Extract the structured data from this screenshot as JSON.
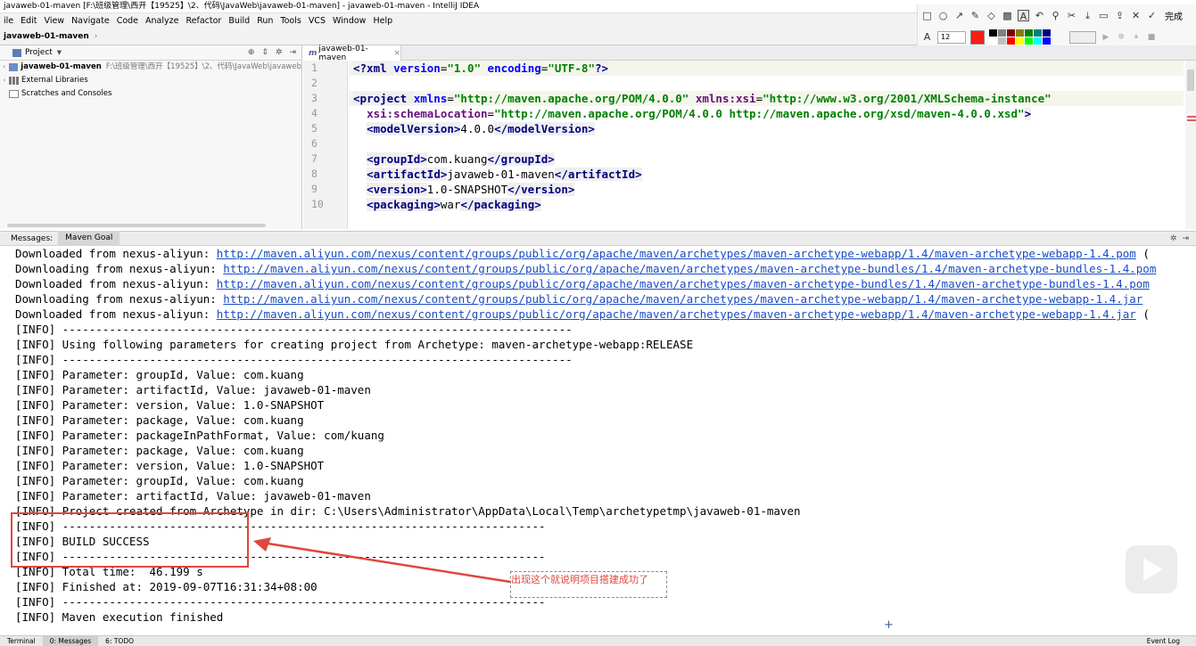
{
  "window": {
    "title": "javaweb-01-maven [F:\\班级管理\\西开【19525】\\2、代码\\JavaWeb\\javaweb-01-maven] - javaweb-01-maven - IntelliJ IDEA"
  },
  "menu": [
    "ile",
    "Edit",
    "View",
    "Navigate",
    "Code",
    "Analyze",
    "Refactor",
    "Build",
    "Run",
    "Tools",
    "VCS",
    "Window",
    "Help"
  ],
  "breadcrumb": {
    "project": "javaweb-01-maven"
  },
  "annotation_toolbar": {
    "done_label": "完成",
    "font_size": "12",
    "active_color": "#ff1a1a",
    "palette": [
      "#000000",
      "#808080",
      "#800000",
      "#808000",
      "#008000",
      "#008080",
      "#000080",
      "#ffffff",
      "#c0c0c0",
      "#ff0000",
      "#ffff00",
      "#00ff00",
      "#00ffff",
      "#0000ff"
    ]
  },
  "project_panel": {
    "title": "Project",
    "tree": [
      {
        "label": "javaweb-01-maven",
        "path": "F:\\班级管理\\西开【19525】\\2、代码\\JavaWeb\\javaweb"
      },
      {
        "label": "External Libraries"
      },
      {
        "label": "Scratches and Consoles"
      }
    ]
  },
  "editor": {
    "tab_label": "javaweb-01-maven",
    "lines": [
      "1",
      "2",
      "3",
      "4",
      "5",
      "6",
      "7",
      "8",
      "9",
      "10"
    ],
    "code": {
      "l1_a": "<?xml ",
      "l1_attr1": "version",
      "l1_eq1": "=",
      "l1_v1": "\"1.0\"",
      "l1_sp": " ",
      "l1_attr2": "encoding",
      "l1_eq2": "=",
      "l1_v2": "\"UTF-8\"",
      "l1_end": "?>",
      "l3_tag": "<project ",
      "l3_attr1": "xmlns",
      "l3_eq1": "=",
      "l3_v1": "\"http://maven.apache.org/POM/4.0.0\"",
      "l3_sp": " ",
      "l3_attr2": "xmlns:xsi",
      "l3_eq2": "=",
      "l3_v2": "\"http://www.w3.org/2001/XMLSchema-instance\"",
      "l4_indent": "  ",
      "l4_attr": "xsi:schemaLocation",
      "l4_eq": "=",
      "l4_v": "\"http://maven.apache.org/POM/4.0.0 http://maven.apache.org/xsd/maven-4.0.0.xsd\"",
      "l4_end": ">",
      "l5_open": "<modelVersion>",
      "l5_text": "4.0.0",
      "l5_close": "</modelVersion>",
      "l7_open": "<groupId>",
      "l7_text": "com.kuang",
      "l7_close": "</groupId>",
      "l8_open": "<artifactId>",
      "l8_text": "javaweb-01-maven",
      "l8_close": "</artifactId>",
      "l9_open": "<version>",
      "l9_text": "1.0-SNAPSHOT",
      "l9_close": "</version>",
      "l10_open": "<packaging>",
      "l10_text": "war",
      "l10_close": "</packaging>"
    }
  },
  "messages": {
    "label": "Messages:",
    "tab": "Maven Goal",
    "lines": [
      {
        "prefix": "Downloaded from nexus-aliyun: ",
        "link": "http://maven.aliyun.com/nexus/content/groups/public/org/apache/maven/archetypes/maven-archetype-webapp/1.4/maven-archetype-webapp-1.4.pom",
        "suffix": " ("
      },
      {
        "prefix": "Downloading from nexus-aliyun: ",
        "link": "http://maven.aliyun.com/nexus/content/groups/public/org/apache/maven/archetypes/maven-archetype-bundles/1.4/maven-archetype-bundles-1.4.pom",
        "suffix": ""
      },
      {
        "prefix": "Downloaded from nexus-aliyun: ",
        "link": "http://maven.aliyun.com/nexus/content/groups/public/org/apache/maven/archetypes/maven-archetype-bundles/1.4/maven-archetype-bundles-1.4.pom",
        "suffix": ""
      },
      {
        "prefix": "Downloading from nexus-aliyun: ",
        "link": "http://maven.aliyun.com/nexus/content/groups/public/org/apache/maven/archetypes/maven-archetype-webapp/1.4/maven-archetype-webapp-1.4.jar",
        "suffix": ""
      },
      {
        "prefix": "Downloaded from nexus-aliyun: ",
        "link": "http://maven.aliyun.com/nexus/content/groups/public/org/apache/maven/archetypes/maven-archetype-webapp/1.4/maven-archetype-webapp-1.4.jar",
        "suffix": " ("
      },
      {
        "prefix": "[INFO] ----------------------------------------------------------------------------",
        "link": "",
        "suffix": ""
      },
      {
        "prefix": "[INFO] Using following parameters for creating project from Archetype: maven-archetype-webapp:RELEASE",
        "link": "",
        "suffix": ""
      },
      {
        "prefix": "[INFO] ----------------------------------------------------------------------------",
        "link": "",
        "suffix": ""
      },
      {
        "prefix": "[INFO] Parameter: groupId, Value: com.kuang",
        "link": "",
        "suffix": ""
      },
      {
        "prefix": "[INFO] Parameter: artifactId, Value: javaweb-01-maven",
        "link": "",
        "suffix": ""
      },
      {
        "prefix": "[INFO] Parameter: version, Value: 1.0-SNAPSHOT",
        "link": "",
        "suffix": ""
      },
      {
        "prefix": "[INFO] Parameter: package, Value: com.kuang",
        "link": "",
        "suffix": ""
      },
      {
        "prefix": "[INFO] Parameter: packageInPathFormat, Value: com/kuang",
        "link": "",
        "suffix": ""
      },
      {
        "prefix": "[INFO] Parameter: package, Value: com.kuang",
        "link": "",
        "suffix": ""
      },
      {
        "prefix": "[INFO] Parameter: version, Value: 1.0-SNAPSHOT",
        "link": "",
        "suffix": ""
      },
      {
        "prefix": "[INFO] Parameter: groupId, Value: com.kuang",
        "link": "",
        "suffix": ""
      },
      {
        "prefix": "[INFO] Parameter: artifactId, Value: javaweb-01-maven",
        "link": "",
        "suffix": ""
      },
      {
        "prefix": "[INFO] Project created from Archetype in dir: C:\\Users\\Administrator\\AppData\\Local\\Temp\\archetypetmp\\javaweb-01-maven",
        "link": "",
        "suffix": ""
      },
      {
        "prefix": "[INFO] ------------------------------------------------------------------------",
        "link": "",
        "suffix": ""
      },
      {
        "prefix": "[INFO] BUILD SUCCESS",
        "link": "",
        "suffix": ""
      },
      {
        "prefix": "[INFO] ------------------------------------------------------------------------",
        "link": "",
        "suffix": ""
      },
      {
        "prefix": "[INFO] Total time:  46.199 s",
        "link": "",
        "suffix": ""
      },
      {
        "prefix": "[INFO] Finished at: 2019-09-07T16:31:34+08:00",
        "link": "",
        "suffix": ""
      },
      {
        "prefix": "[INFO] ------------------------------------------------------------------------",
        "link": "",
        "suffix": ""
      },
      {
        "prefix": "[INFO] Maven execution finished",
        "link": "",
        "suffix": ""
      }
    ]
  },
  "annotation": {
    "note": "出现这个就说明项目搭建成功了"
  },
  "statusbar": {
    "terminal": "Terminal",
    "messages": "0: Messages",
    "todo": "6: TODO",
    "event": "Event Log"
  }
}
